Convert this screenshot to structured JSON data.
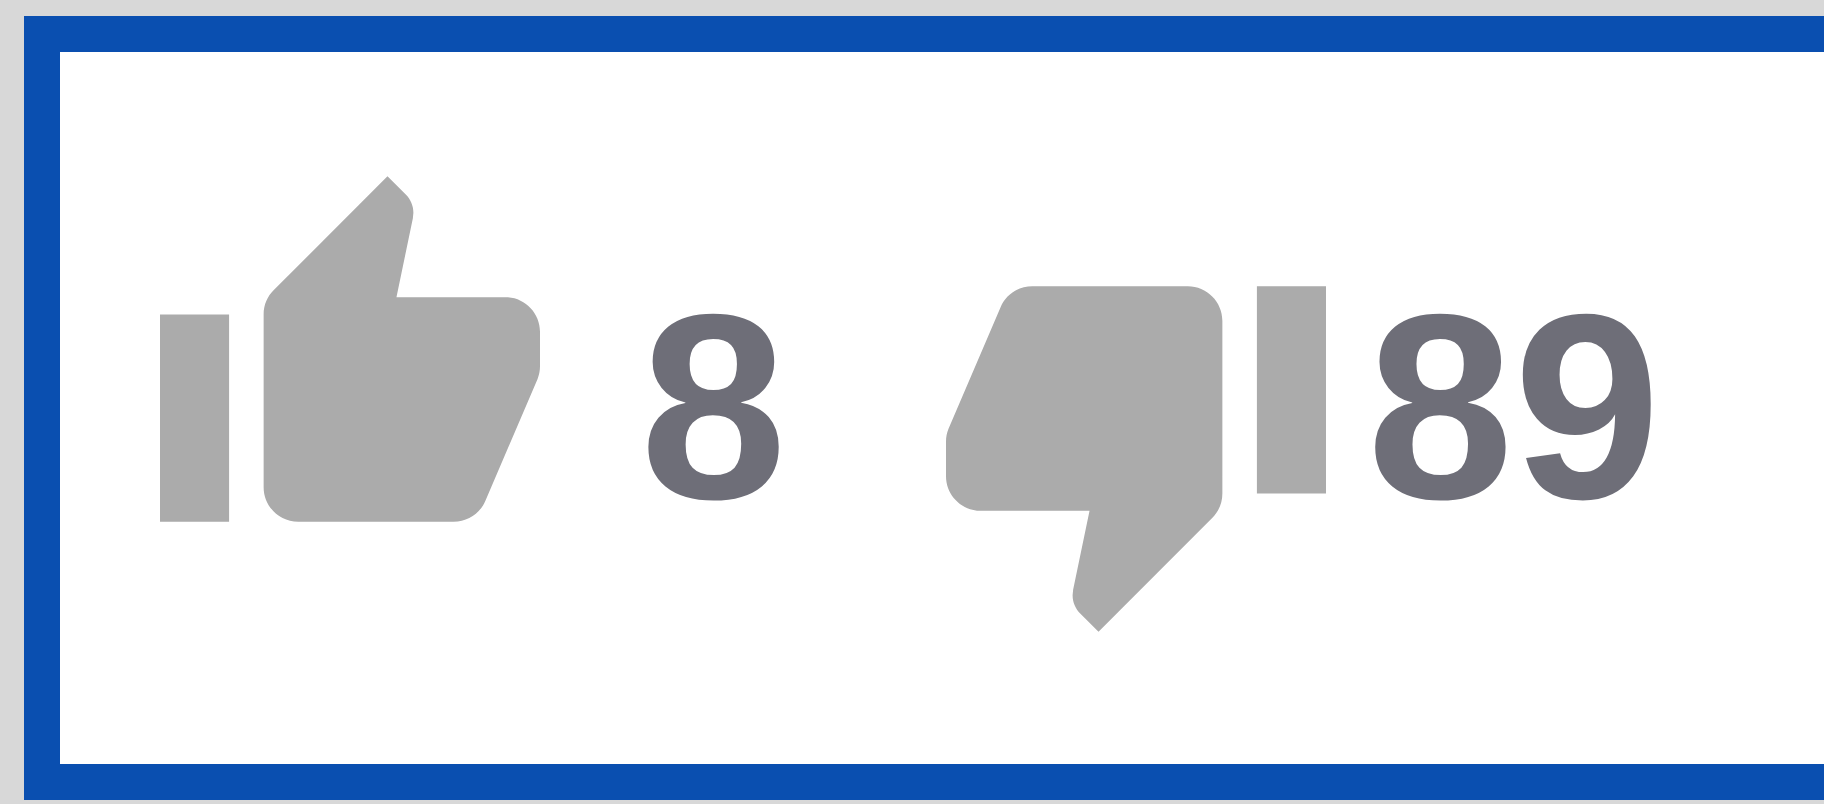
{
  "votes": [
    {
      "kind": "up",
      "count": "8"
    },
    {
      "kind": "down",
      "count": "89"
    }
  ]
}
